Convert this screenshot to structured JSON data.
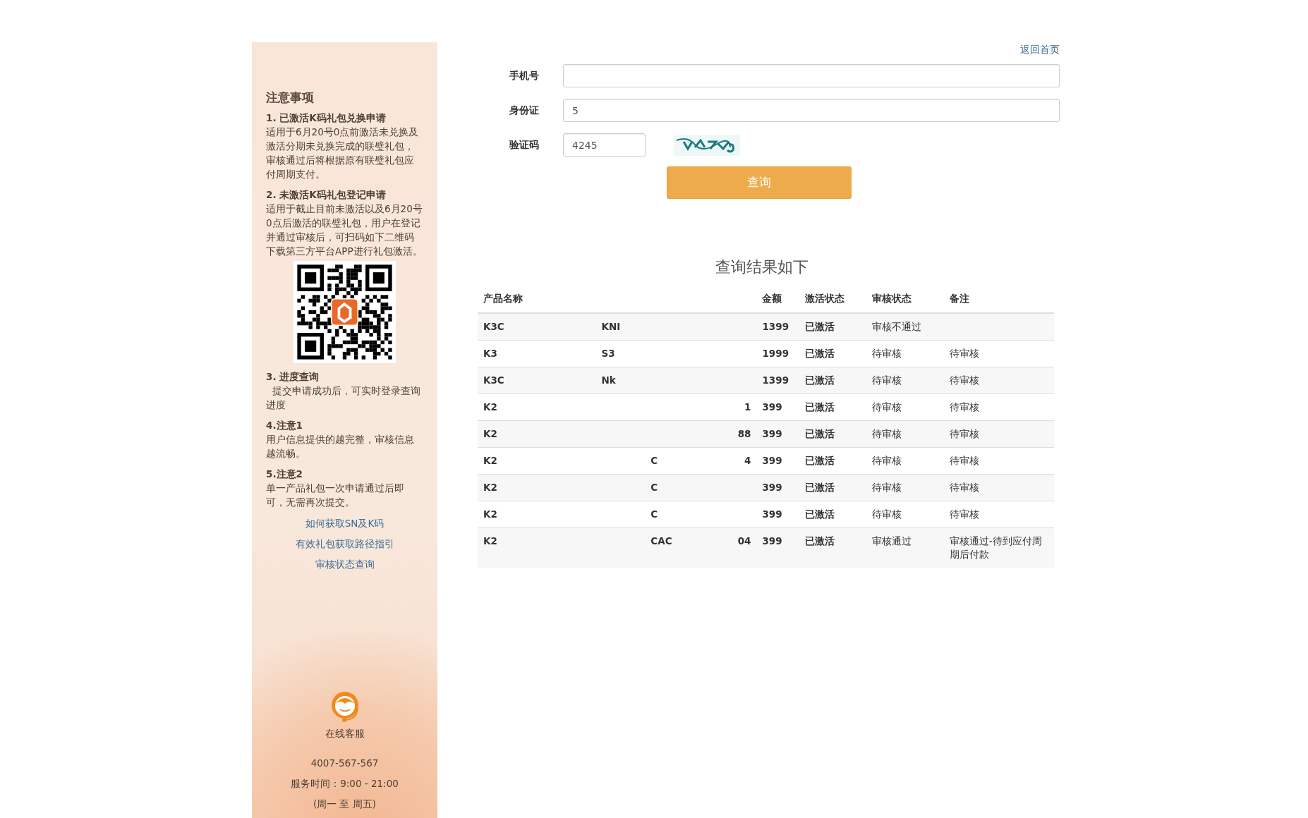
{
  "sidebar": {
    "heading": "注意事项",
    "sections": [
      {
        "kind": "text",
        "title": "1. 已激活K码礼包兑换申请",
        "body": "适用于6月20号0点前激活未兑换及激活分期未兑换完成的联璧礼包，审核通过后将根据原有联璧礼包应付周期支付。"
      },
      {
        "kind": "qr",
        "title": "2. 未激活K码礼包登记申请",
        "body": "适用于截止目前未激活以及6月20号0点后激活的联璧礼包，用户在登记并通过审核后，可扫码如下二维码下载第三方平台APP进行礼包激活。"
      },
      {
        "kind": "text",
        "title": "3. 进度查询",
        "body": "  提交申请成功后，可实时登录查询进度"
      },
      {
        "kind": "text",
        "title": "4.注意1",
        "body": "用户信息提供的越完整，审核信息越流畅。"
      },
      {
        "kind": "text",
        "title": "5.注意2",
        "body": "单一产品礼包一次申请通过后即可，无需再次提交。"
      }
    ],
    "links": [
      "如何获取SN及K码",
      "有效礼包获取路径指引",
      "审核状态查询"
    ],
    "service": {
      "label": "在线客服",
      "phone": "4007-567-567",
      "hours": "服务时间：9:00 - 21:00",
      "days": "(周一 至 周五)"
    }
  },
  "top_link": "返回首页",
  "form": {
    "fields": [
      {
        "label": "手机号",
        "kind": "text"
      },
      {
        "label": "身份证",
        "kind": "text",
        "value": "5"
      },
      {
        "label": "验证码",
        "kind": "captcha",
        "value": "4245"
      }
    ],
    "submit": "查询"
  },
  "results": {
    "title": "查询结果如下",
    "columns": [
      "产品名称",
      null,
      null,
      null,
      "金额",
      "激活状态",
      "审核状态",
      "备注"
    ],
    "rows": [
      [
        "K3C",
        "KNI",
        null,
        null,
        "1399",
        "已激活",
        "审核不通过",
        null
      ],
      [
        "K3",
        "S3",
        null,
        null,
        "1999",
        "已激活",
        "待审核",
        "待审核"
      ],
      [
        "K3C",
        "Nk",
        null,
        null,
        "1399",
        "已激活",
        "待审核",
        "待审核"
      ],
      [
        "K2",
        null,
        null,
        "1",
        "399",
        "已激活",
        "待审核",
        "待审核"
      ],
      [
        "K2",
        null,
        null,
        "88",
        "399",
        "已激活",
        "待审核",
        "待审核"
      ],
      [
        "K2",
        null,
        "C",
        "4",
        "399",
        "已激活",
        "待审核",
        "待审核"
      ],
      [
        "K2",
        null,
        "C",
        null,
        "399",
        "已激活",
        "待审核",
        "待审核"
      ],
      [
        "K2",
        null,
        "C",
        null,
        "399",
        "已激活",
        "待审核",
        "待审核"
      ],
      [
        "K2",
        null,
        "CAC",
        "04",
        "399",
        "已激活",
        "审核通过",
        "审核通过-待到应付周期后付款"
      ]
    ]
  }
}
